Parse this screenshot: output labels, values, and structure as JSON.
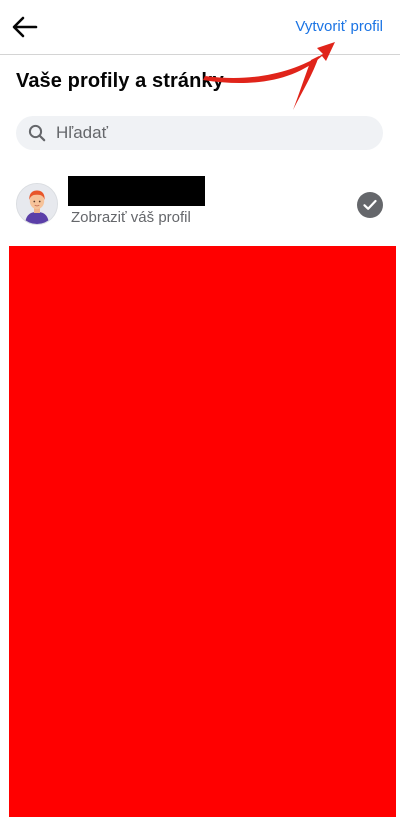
{
  "header": {
    "back_icon": "arrow-left-icon",
    "create_profile_label": "Vytvoriť profil",
    "accent_color": "#1b74e4"
  },
  "page": {
    "title": "Vaše profily a stránky"
  },
  "search": {
    "icon": "search-icon",
    "placeholder": "Hľadať"
  },
  "profiles": [
    {
      "name": "",
      "subtitle": "Zobraziť váš profil",
      "selected": true,
      "avatar_icon": "person-avatar-icon"
    }
  ],
  "redactions": {
    "name_color": "#000000",
    "content_color": "#ff0000"
  },
  "annotation": {
    "arrow_color": "#e0241a",
    "arrow_icon": "annotation-arrow-icon"
  }
}
